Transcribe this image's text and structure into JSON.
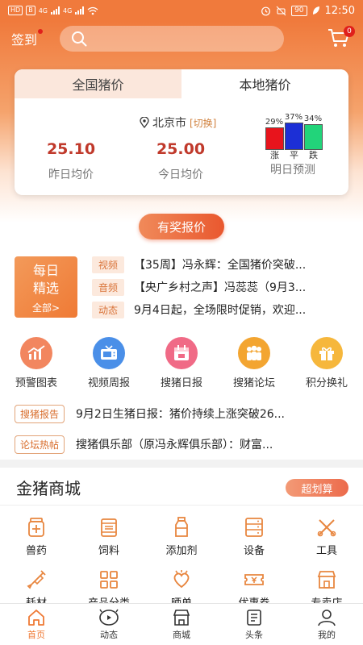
{
  "status_bar": {
    "left_chips": [
      "HD",
      "B"
    ],
    "network_labels": [
      "4G",
      "4G"
    ],
    "battery": "90",
    "time": "12:50"
  },
  "header": {
    "signin_label": "签到",
    "search_placeholder": "",
    "cart_badge": "0"
  },
  "price_card": {
    "tabs": [
      {
        "label": "全国猪价",
        "selected": false
      },
      {
        "label": "本地猪价",
        "selected": true
      }
    ],
    "city": "北京市",
    "switch_label": "[切换]",
    "yesterday": {
      "value": "25.10",
      "label": "昨日均价"
    },
    "today": {
      "value": "25.00",
      "label": "今日均价"
    },
    "forecast": {
      "title": "明日预测",
      "items": [
        {
          "pct": "29%",
          "label": "涨",
          "value": 29,
          "color": "#e8141c"
        },
        {
          "pct": "37%",
          "label": "平",
          "value": 37,
          "color": "#1c2fd6"
        },
        {
          "pct": "34%",
          "label": "跌",
          "value": 34,
          "color": "#22d47a"
        }
      ]
    }
  },
  "reward_button": "有奖报价",
  "daily": {
    "title_line1": "每日",
    "title_line2": "精选",
    "more": "全部>"
  },
  "news": [
    {
      "tag": "视频",
      "text": "【35周】冯永辉：全国猪价突破..."
    },
    {
      "tag": "音频",
      "text": "【央广乡村之声】冯蕊蕊（9月3..."
    },
    {
      "tag": "动态",
      "text": "9月4日起，全场限时促销，欢迎..."
    }
  ],
  "quick_links": [
    {
      "label": "预警图表",
      "icon": "chart-icon",
      "color": "#f2865f"
    },
    {
      "label": "视频周报",
      "icon": "tv-icon",
      "color": "#4a8fe8"
    },
    {
      "label": "搜猪日报",
      "icon": "calendar-icon",
      "color": "#f06a86"
    },
    {
      "label": "搜猪论坛",
      "icon": "people-icon",
      "color": "#f3a531"
    },
    {
      "label": "积分换礼",
      "icon": "gift-icon",
      "color": "#f6b73c"
    }
  ],
  "reports": [
    {
      "tag": "搜猪报告",
      "text": "9月2日生猪日报：猪价持续上涨突破26..."
    },
    {
      "tag": "论坛热帖",
      "text": "搜猪俱乐部（原冯永辉俱乐部）：财富..."
    }
  ],
  "mall": {
    "title": "金猪商城",
    "deal_button": "超划算",
    "items": [
      {
        "label": "兽药",
        "icon": "medicine-icon"
      },
      {
        "label": "饲料",
        "icon": "feed-icon"
      },
      {
        "label": "添加剂",
        "icon": "bottle-icon"
      },
      {
        "label": "设备",
        "icon": "equipment-icon"
      },
      {
        "label": "工具",
        "icon": "tools-icon"
      },
      {
        "label": "耗材",
        "icon": "syringe-icon"
      },
      {
        "label": "产品分类",
        "icon": "category-icon"
      },
      {
        "label": "晒单",
        "icon": "heart-icon"
      },
      {
        "label": "优惠券",
        "icon": "coupon-icon"
      },
      {
        "label": "专卖店",
        "icon": "store-icon"
      }
    ]
  },
  "bottom_nav": [
    {
      "label": "首页",
      "icon": "home-icon",
      "active": true
    },
    {
      "label": "动态",
      "icon": "pig-play-icon",
      "active": false
    },
    {
      "label": "商城",
      "icon": "shop-icon",
      "active": false
    },
    {
      "label": "头条",
      "icon": "news-icon",
      "active": false
    },
    {
      "label": "我的",
      "icon": "user-icon",
      "active": false
    }
  ],
  "colors": {
    "brand": "#f07a3c",
    "accent_red": "#c0392b",
    "tag_text": "#d9743a"
  }
}
